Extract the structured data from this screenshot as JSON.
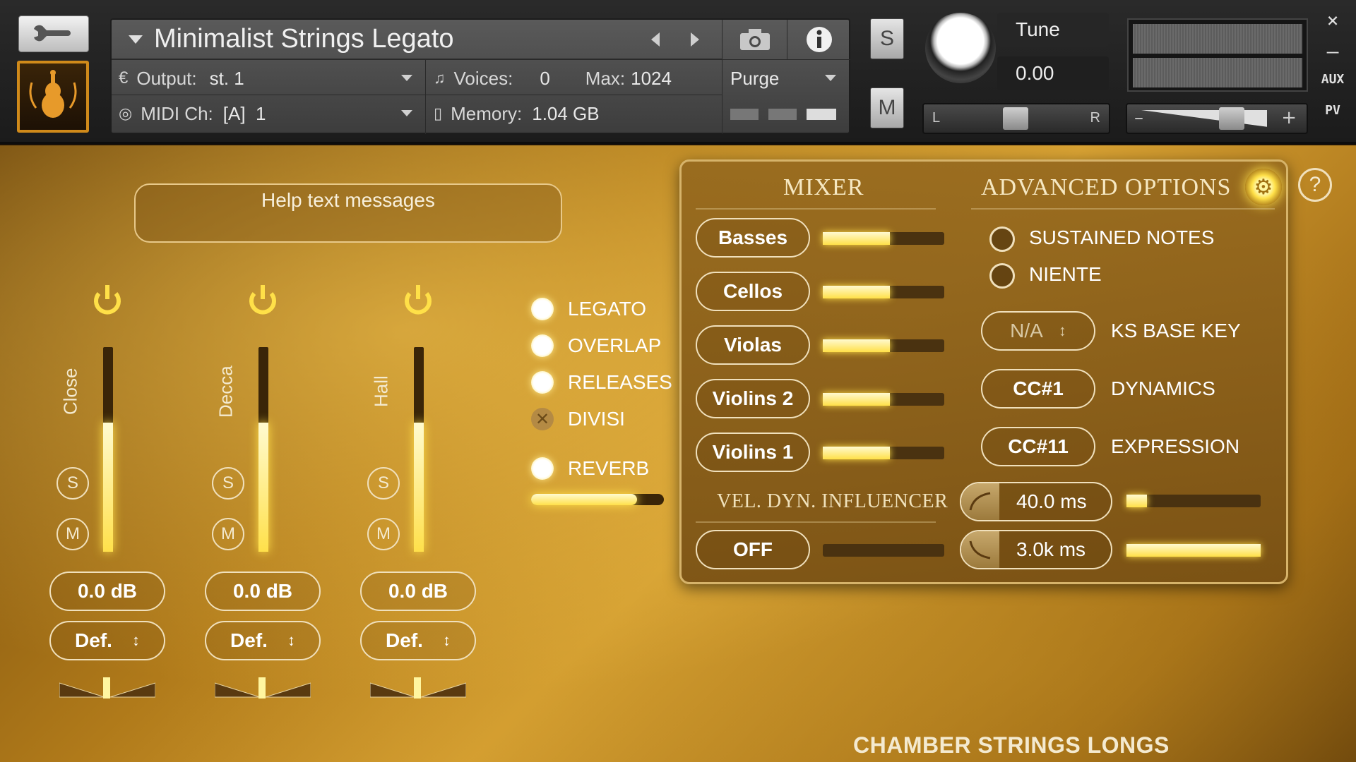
{
  "header": {
    "instrument_title": "Minimalist Strings Legato",
    "output_label": "Output:",
    "output_value": "st. 1",
    "midi_label": "MIDI Ch:",
    "midi_value": "[A]  1",
    "voices_label": "Voices:",
    "voices_value": "0",
    "max_label": "Max:",
    "max_value": "1024",
    "memory_label": "Memory:",
    "memory_value": "1.04 GB",
    "purge_label": "Purge",
    "solo_label": "S",
    "mute_label": "M",
    "tune_label": "Tune",
    "tune_value": "0.00",
    "pan_left": "L",
    "pan_right": "R",
    "vol_minus": "–",
    "vol_plus": "+",
    "close_label": "×",
    "minimize_label": "–",
    "aux_label": "AUX",
    "pv_label": "PV"
  },
  "help": {
    "text": "Help text messages"
  },
  "channels": [
    {
      "name": "Close",
      "solo": "S",
      "mute": "M",
      "gain": "0.0 dB",
      "preset": "Def.",
      "level": 0.63
    },
    {
      "name": "Decca",
      "solo": "S",
      "mute": "M",
      "gain": "0.0 dB",
      "preset": "Def.",
      "level": 0.63
    },
    {
      "name": "Hall",
      "solo": "S",
      "mute": "M",
      "gain": "0.0 dB",
      "preset": "Def.",
      "level": 0.63
    }
  ],
  "options": {
    "legato": "LEGATO",
    "overlap": "OVERLAP",
    "releases": "RELEASES",
    "divisi": "DIVISI",
    "reverb": "REVERB",
    "reverb_level": 0.8
  },
  "mixer": {
    "mixer_title": "MIXER",
    "advanced_title": "ADVANCED OPTIONS",
    "help_symbol": "?",
    "sections": [
      {
        "label": "Basses",
        "level": 0.55
      },
      {
        "label": "Cellos",
        "level": 0.55
      },
      {
        "label": "Violas",
        "level": 0.55
      },
      {
        "label": "Violins 2",
        "level": 0.55
      },
      {
        "label": "Violins 1",
        "level": 0.55
      }
    ],
    "vel_dyn_label": "VEL. DYN. INFLUENCER",
    "vel_dyn_value": "OFF",
    "sustained_notes": "SUSTAINED NOTES",
    "niente": "NIENTE",
    "ks_base_value": "N/A",
    "ks_base_label": "KS BASE KEY",
    "dynamics_cc": "CC#1",
    "dynamics_label": "DYNAMICS",
    "expression_cc": "CC#11",
    "expression_label": "EXPRESSION",
    "attack_time": "40.0 ms",
    "attack_level": 0.15,
    "release_time": "3.0k ms",
    "release_level": 1.0
  },
  "footer": {
    "library_name": "CHAMBER STRINGS LONGS"
  },
  "colors": {
    "accent": "#ffe048",
    "panel_border": "#d6b36a",
    "frame_orange": "#d08a1a"
  }
}
